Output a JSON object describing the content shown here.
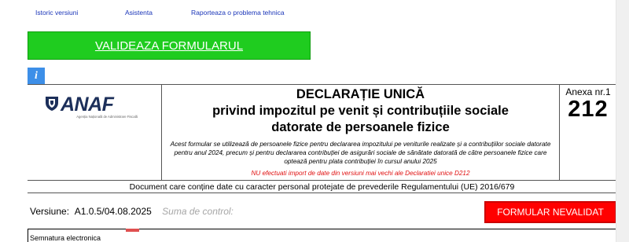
{
  "top_links": [
    {
      "label": "Istoric versiuni"
    },
    {
      "label": "Asistenta"
    },
    {
      "label": "Raporteaza o problema tehnica"
    }
  ],
  "validate_button": {
    "label": "VALIDEAZA FORMULARUL",
    "color": "#1fcc1f"
  },
  "info_icon": {
    "glyph": "i",
    "icon": "info-icon"
  },
  "logo": {
    "wordmark": "ANAF",
    "subtitle": "Agenția Națională de Administrare Fiscală"
  },
  "header": {
    "title_line1": "DECLARAȚIE UNICĂ",
    "title_line2": "privind impozitul pe venit și contribuțiile sociale",
    "title_line3": "datorate de persoanele fizice",
    "description": "Acest formular se utilizează de persoanele fizice pentru declararea impozitului pe veniturile realizate și a contribuțiilor sociale datorate pentru anul 2024, precum și pentru declararea contribuției de asigurări sociale de sănătate datorată de către persoanele fizice care optează pentru plata contribuției în cursul anului 2025",
    "warning": "NU efectuati import de date din versiuni mai vechi ale Declaratiei unice D212",
    "anexa_label": "Anexa nr.1",
    "anexa_number": "212"
  },
  "gdpr_notice": "Document care conține date cu caracter personal protejate de prevederile Regulamentului (UE) 2016/679",
  "version": {
    "label": "Versiune:",
    "value": "A1.0.5/04.08.2025",
    "checksum_label": "Suma de control:"
  },
  "status_button": {
    "label": "FORMULAR NEVALIDAT",
    "color": "#ff0000"
  },
  "signature": {
    "label": "Semnatura electronica"
  }
}
